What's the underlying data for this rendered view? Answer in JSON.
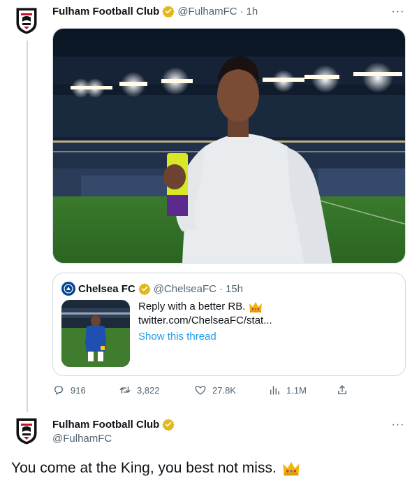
{
  "tweet": {
    "author_name": "Fulham Football Club",
    "handle": "@FulhamFC",
    "separator": "·",
    "time": "1h",
    "more": "···"
  },
  "quote": {
    "author_name": "Chelsea FC",
    "handle": "@ChelseaFC",
    "separator": "·",
    "time": "15h",
    "text": "Reply with a better RB.",
    "link": "twitter.com/ChelseaFC/stat...",
    "show_thread": "Show this thread"
  },
  "actions": {
    "replies": "916",
    "retweets": "3,822",
    "likes": "27.8K",
    "views": "1.1M"
  },
  "reply": {
    "author_name": "Fulham Football Club",
    "handle": "@FulhamFC",
    "more": "···",
    "text": "You come at the King, you best not miss."
  },
  "colors": {
    "fulham_black": "#0f0f0f",
    "chelsea_blue": "#034694",
    "verified_gold": "#e2b719",
    "link_blue": "#1d9bf0",
    "muted": "#536471",
    "border": "#cfd9de"
  },
  "icons": {
    "verified": "verified-gold-badge",
    "reply": "reply-icon",
    "retweet": "retweet-icon",
    "like": "heart-icon",
    "views": "views-icon",
    "share": "share-icon",
    "crown": "crown-emoji"
  }
}
